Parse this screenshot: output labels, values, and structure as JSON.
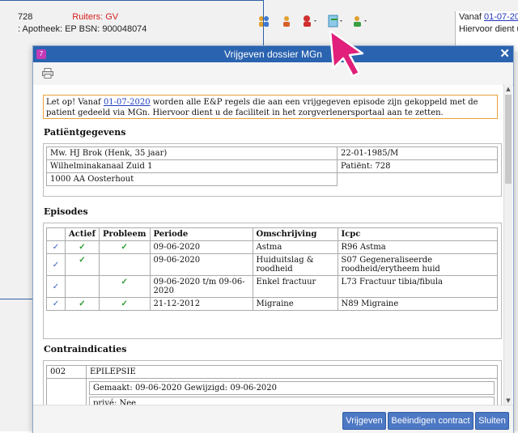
{
  "background": {
    "patient_number": "728",
    "ruiters_label": "Ruiters: GV",
    "apotheek_line": ": Apotheek: EP BSN: 900048074",
    "right_panel": {
      "prefix": "Vanaf ",
      "date_link": "01-07-20",
      "line2": "Hiervoor dient u"
    }
  },
  "dialog": {
    "title": "Vrijgeven dossier MGn",
    "close_label": "✕",
    "notice": {
      "part1": "Let op! Vanaf ",
      "date_link": "01-07-2020",
      "part2": " worden alle E&P regels die aan een vrijgegeven episode zijn gekoppeld met de patient gedeeld via MGn. Hiervoor dient u de faciliteit in het zorgverlenersportaal aan te zetten."
    },
    "patient_section": {
      "heading": "Patiëntgegevens",
      "name": "Mw. HJ Brok (Henk, 35 jaar)",
      "dob_gender": "22-01-1985/M",
      "address": "Wilhelminakanaal Zuid 1",
      "patient_id": "Patiënt: 728",
      "city": "1000 AA Oosterhout"
    },
    "episodes_section": {
      "heading": "Episodes",
      "columns": [
        "",
        "Actief",
        "Probleem",
        "Periode",
        "Omschrijving",
        "Icpc"
      ],
      "rows": [
        {
          "selected": "✓",
          "actief": "✓",
          "probleem": "✓",
          "periode": "09-06-2020",
          "omschrijving": "Astma",
          "icpc": "R96 Astma"
        },
        {
          "selected": "✓",
          "actief": "✓",
          "probleem": "",
          "periode": "09-06-2020",
          "omschrijving": "Huiduitslag & roodheid",
          "icpc": "S07 Gegeneraliseerde roodheid/erytheem huid"
        },
        {
          "selected": "✓",
          "actief": "",
          "probleem": "✓",
          "periode": "09-06-2020 t/m 09-06-2020",
          "omschrijving": "Enkel fractuur",
          "icpc": "L73 Fractuur tibia/fibula"
        },
        {
          "selected": "✓",
          "actief": "✓",
          "probleem": "✓",
          "periode": "21-12-2012",
          "omschrijving": "Migraine",
          "icpc": "N89 Migraine"
        }
      ]
    },
    "contra_section": {
      "heading": "Contraindicaties",
      "code": "002",
      "name": "EPILEPSIE",
      "meta": "Gemaakt: 09-06-2020    Gewijzigd: 09-06-2020",
      "prive": "privé: Nee"
    },
    "buttons": {
      "vrijgeven": "Vrijgeven",
      "beeindigen": "Beëindigen contract",
      "sluiten": "Sluiten"
    }
  },
  "colors": {
    "titlebar": "#2a63b0",
    "button": "#4d78c4",
    "notice_border": "#e8a23a",
    "check": "#2b9a2b",
    "cursor": "#e0207a"
  }
}
